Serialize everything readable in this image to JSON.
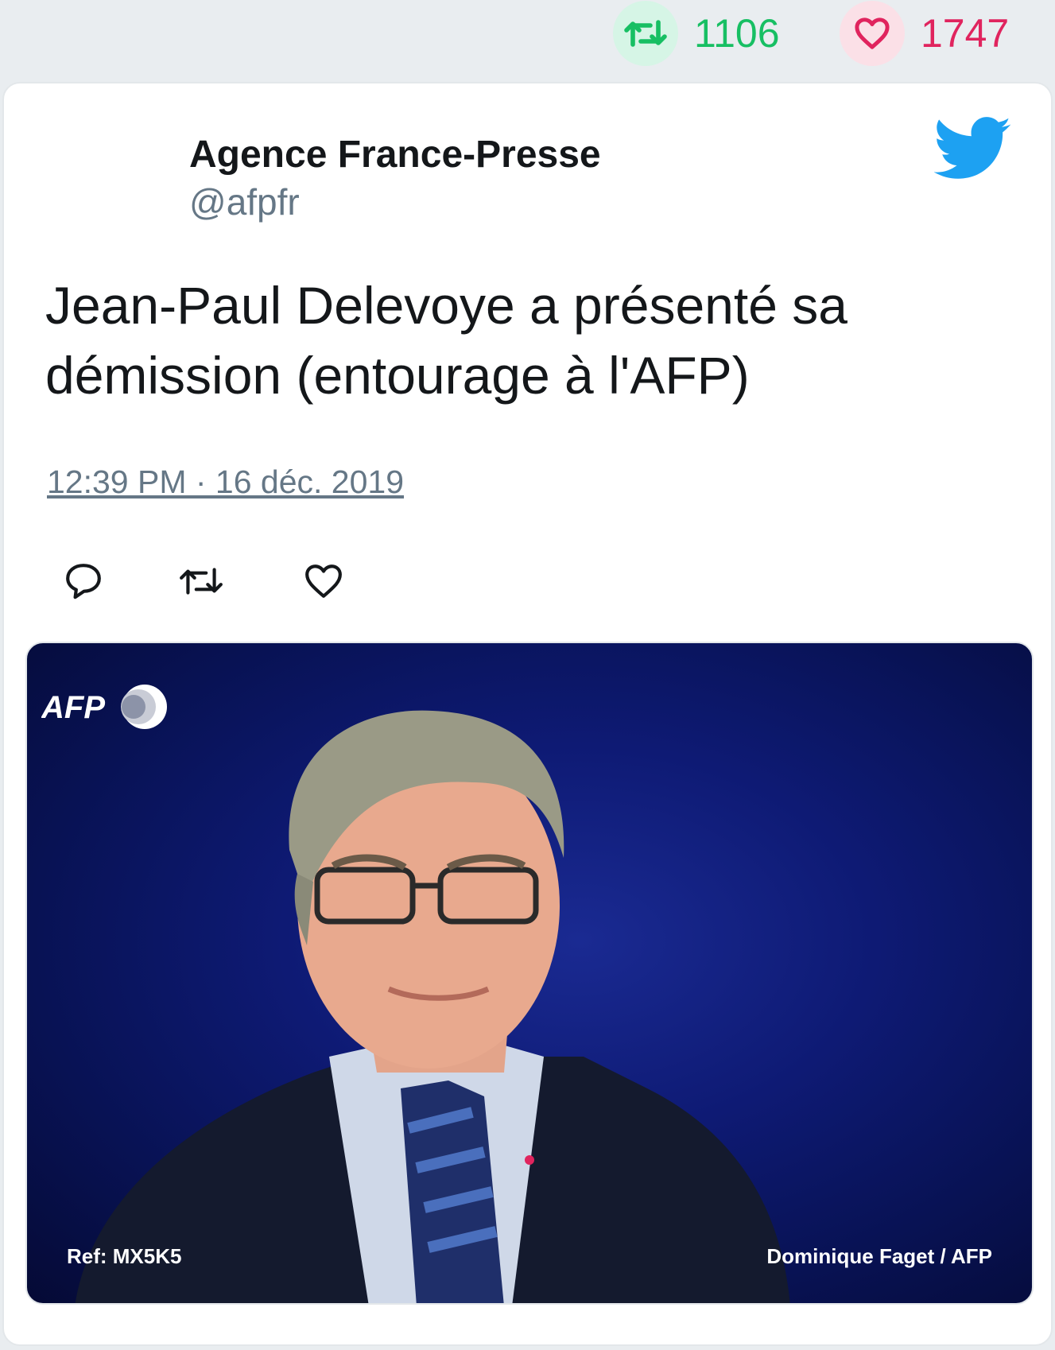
{
  "stats": {
    "retweet_count": "1106",
    "like_count": "1747",
    "retweet_icon": "retweet-icon",
    "like_icon": "heart-icon",
    "retweet_color": "#17bf63",
    "like_color": "#e0245e"
  },
  "tweet": {
    "author_name": "Agence France-Presse",
    "author_handle": "@afpfr",
    "text": "Jean-Paul Delevoye a présenté sa démission (entourage à l'AFP)",
    "timestamp": "12:39 PM · 16 déc. 2019",
    "brand_icon": "twitter-bird-icon",
    "brand_color": "#1da1f2",
    "actions": [
      {
        "name": "reply",
        "icon": "reply-icon"
      },
      {
        "name": "retweet",
        "icon": "retweet-icon"
      },
      {
        "name": "like",
        "icon": "heart-icon"
      }
    ]
  },
  "media": {
    "logo_text": "AFP",
    "ref_text": "Ref: MX5K5",
    "credit_text": "Dominique Faget / AFP"
  }
}
